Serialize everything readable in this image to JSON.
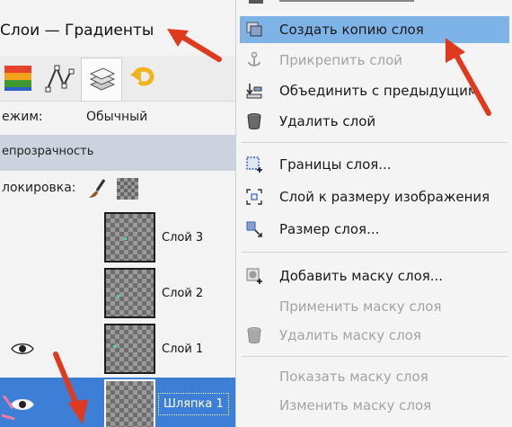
{
  "layers_dock": {
    "title": "Слои — Градиенты",
    "mode_label": "ежим:",
    "mode_value": "Обычный",
    "opacity_label": "епрозрачность",
    "lock_label": "локировка:",
    "layers": [
      {
        "name": "Слой 3",
        "visible": false,
        "selected": false
      },
      {
        "name": "Слой 2",
        "visible": false,
        "selected": false
      },
      {
        "name": "Слой 1",
        "visible": true,
        "selected": false
      },
      {
        "name": "Шляпка 1",
        "visible": true,
        "selected": true
      }
    ]
  },
  "context_menu": {
    "items": [
      {
        "label": "Создать копию слоя",
        "icon": "duplicate-layer-icon",
        "state": "highlighted"
      },
      {
        "label": "Прикрепить слой",
        "icon": "anchor-icon",
        "state": "disabled"
      },
      {
        "label": "Объединить с предыдущим",
        "icon": "merge-down-icon",
        "state": "enabled"
      },
      {
        "label": "Удалить слой",
        "icon": "trash-icon",
        "state": "enabled"
      },
      {
        "label": "Границы слоя...",
        "icon": "layer-boundary-icon",
        "state": "enabled"
      },
      {
        "label": "Слой к размеру изображения",
        "icon": "layer-to-image-size-icon",
        "state": "enabled"
      },
      {
        "label": "Размер слоя...",
        "icon": "scale-layer-icon",
        "state": "enabled"
      },
      {
        "label": "Добавить маску слоя...",
        "icon": "add-mask-icon",
        "state": "enabled"
      },
      {
        "label": "Применить маску слоя",
        "icon": "",
        "state": "disabled"
      },
      {
        "label": "Удалить маску слоя",
        "icon": "trash-icon",
        "state": "disabled"
      },
      {
        "label": "Показать маску слоя",
        "icon": "",
        "state": "disabled"
      },
      {
        "label": "Изменить маску слоя",
        "icon": "",
        "state": "disabled"
      }
    ]
  },
  "colors": {
    "menu_highlight": "#7eb3e8",
    "layer_selected": "#3d7fd6",
    "annotation_arrow": "#e03a1e",
    "opacity_bar": "#ccd3df"
  }
}
